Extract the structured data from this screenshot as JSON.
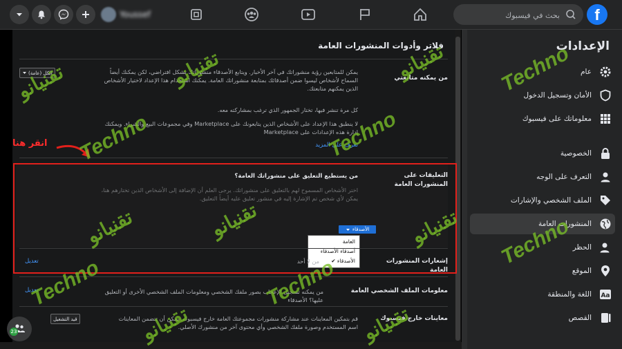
{
  "topbar": {
    "logo": "f",
    "search_placeholder": "بحث في فيسبوك",
    "profile_name": "Youssef",
    "icons": [
      "home-icon",
      "pages-flag-icon",
      "watch-video-icon",
      "groups-icon",
      "gaming-icon"
    ],
    "actions": [
      "plus-icon",
      "messenger-icon",
      "notifications-bell-icon",
      "account-menu-icon"
    ]
  },
  "sidebar": {
    "title": "الإعدادات",
    "items": [
      {
        "label": "عام",
        "icon": "gear-icon"
      },
      {
        "label": "الأمان وتسجيل الدخول",
        "icon": "shield-icon"
      },
      {
        "label": "معلوماتك على فيسبوك",
        "icon": "grid-icon"
      },
      {
        "label": "الخصوصية",
        "icon": "lock-icon"
      },
      {
        "label": "التعرف على الوجه",
        "icon": "face-icon"
      },
      {
        "label": "الملف الشخصي والإشارات",
        "icon": "tag-icon"
      },
      {
        "label": "المنشورات العامة",
        "icon": "globe-icon"
      },
      {
        "label": "الحظر",
        "icon": "block-user-icon"
      },
      {
        "label": "الموقع",
        "icon": "location-pin-icon"
      },
      {
        "label": "اللغة والمنطقة",
        "icon": "language-icon"
      },
      {
        "label": "القصص",
        "icon": "stories-icon"
      }
    ]
  },
  "main": {
    "title": "فلاتر وأدوات المنشورات العامة",
    "followers": {
      "label": "من يمكنه متابعتي",
      "text1": "يمكن للمتابعين رؤية منشوراتك في آخر الأخبار. ويتابع الأصدقاء منشوراتك بشكل افتراضي، لكن يمكنك أيضاً السماح لأشخاص ليسوا ضمن أصدقائك بمتابعة منشوراتك العامة. يمكنك استخدام هذا الإعداد لاختيار الأشخاص الذين يمكنهم متابعتك.",
      "text2": "كل مرة تنشر فيها، تختار الجمهور الذي ترغب بمشاركته معه.",
      "text3": "لا ينطبق هذا الإعداد على الأشخاص الذين يتابعونك على Marketplace وفي مجموعات البيع والشراء. ويمكنك إدارة هذه الإعدادات على Marketplace",
      "learn_more": "تعرف على المزيد",
      "select_value": "الكل (عامة)"
    },
    "comments": {
      "label": "التعليقات على المنشورات العامة",
      "question": "من يستطيع التعليق على منشوراتك العامة؟",
      "text": "اختر الأشخاص المسموح لهم بالتعليق على منشوراتك. يرجى العلم أن الإضافة إلى الأشخاص الذين تختارهم هنا، يمكن لأي شخص تم الإشارة إليه في منشور تعليق عليه أيضاً التعليق.",
      "dropdown_value": "الأصدقاء",
      "options": [
        "العامة",
        "أصدقاء الأصدقاء",
        "الأصدقاء"
      ],
      "selected_option": "الأصدقاء"
    },
    "notifications": {
      "label": "إشعارات المنشورات العامة",
      "value": "من لا أحد",
      "edit": "تعديل"
    },
    "profile_info": {
      "label": "معلومات الملف الشخصي العامة",
      "text": "من يمكنه تسجيل الإعجاب بصور ملفك الشخصي ومعلومات الملف الشخصي الأخرى أو التعليق عليها؟ الأصدقاء",
      "edit": "تعديل"
    },
    "off_facebook": {
      "label": "معاينات خارج فيسبوك",
      "text": "قم بتمكين المعاينات عند مشاركة منشورات مجموعتك العامة خارج فيسبوك. يمكن أن تتضمن المعاينات اسم المستخدم وصورة ملفك الشخصي وأي محتوى آخر من منشورك الأصلي.",
      "toggle_label": "قيد التشغيل"
    }
  },
  "annotation": {
    "text": "انقر هنا",
    "color": "#e2201b"
  },
  "watermark": {
    "latin": "Techno",
    "arabic": "تقنيانو",
    "color": "#78be28"
  },
  "chat_badge": "23"
}
